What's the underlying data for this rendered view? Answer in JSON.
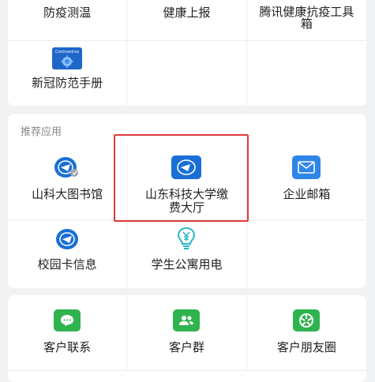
{
  "card1": {
    "row1": [
      {
        "label": "防疫测温"
      },
      {
        "label": "健康上报"
      },
      {
        "label": "腾讯健康抗疫工具箱"
      }
    ],
    "row2": [
      {
        "label": "新冠防范手册",
        "icon": "coronavirus-icon",
        "icon_text": "Coronavirus"
      }
    ]
  },
  "recommended": {
    "title": "推荐应用",
    "row1": [
      {
        "label": "山科大图书馆",
        "icon": "university-library-icon"
      },
      {
        "label": "山东科技大学缴费大厅",
        "icon": "university-payment-icon"
      },
      {
        "label": "企业邮箱",
        "icon": "mail-icon"
      }
    ],
    "row2": [
      {
        "label": "校园卡信息",
        "icon": "campus-card-icon"
      },
      {
        "label": "学生公寓用电",
        "icon": "electricity-yen-icon"
      }
    ]
  },
  "customer": {
    "items": [
      {
        "label": "客户联系",
        "icon": "chat-bubble-icon"
      },
      {
        "label": "客户群",
        "icon": "group-icon"
      },
      {
        "label": "客户朋友圈",
        "icon": "moments-icon"
      }
    ]
  },
  "colors": {
    "university_blue": "#1a6fd6",
    "mail_blue": "#2f86e8",
    "green": "#2fb34f",
    "cyan": "#27b6c9",
    "highlight_red": "#e03a3a"
  }
}
